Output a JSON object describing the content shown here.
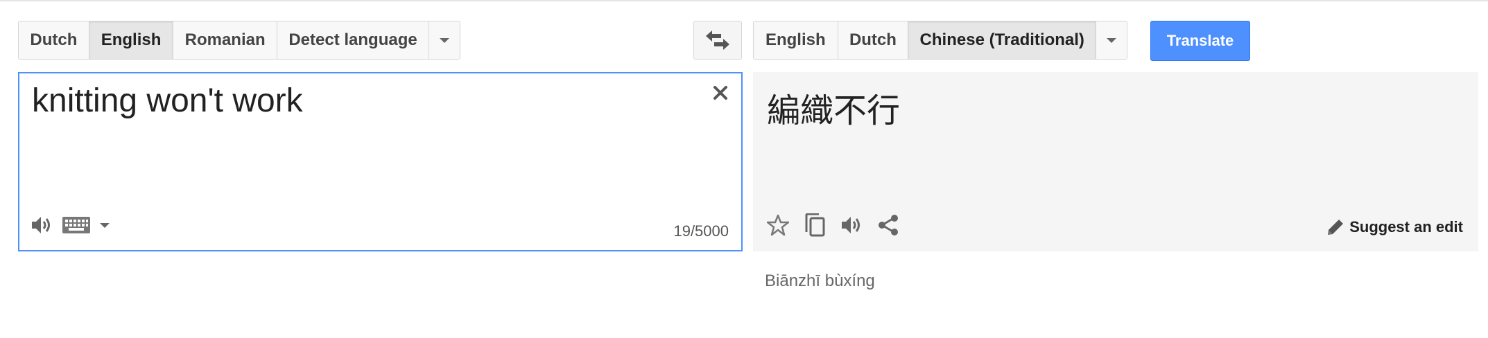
{
  "source_languages": {
    "tabs": [
      {
        "label": "Dutch",
        "selected": false
      },
      {
        "label": "English",
        "selected": true
      },
      {
        "label": "Romanian",
        "selected": false
      },
      {
        "label": "Detect language",
        "selected": false
      }
    ]
  },
  "target_languages": {
    "tabs": [
      {
        "label": "English",
        "selected": false
      },
      {
        "label": "Dutch",
        "selected": false
      },
      {
        "label": "Chinese (Traditional)",
        "selected": true
      }
    ]
  },
  "toolbar": {
    "translate_label": "Translate"
  },
  "source": {
    "text": "knitting won't work",
    "char_count": "19/5000"
  },
  "target": {
    "text": "編織不行",
    "romanization": "Biānzhī bùxíng",
    "suggest_edit_label": "Suggest an edit"
  },
  "icons": {
    "swap": "swap-languages-icon",
    "clear": "close-icon",
    "listen": "speaker-icon",
    "keyboard": "keyboard-icon",
    "star": "star-icon",
    "copy": "copy-icon",
    "share": "share-icon",
    "edit": "pencil-icon"
  },
  "colors": {
    "accent": "#4d90fe",
    "translate_button": "#4d90fe",
    "output_background": "#f5f5f5"
  }
}
